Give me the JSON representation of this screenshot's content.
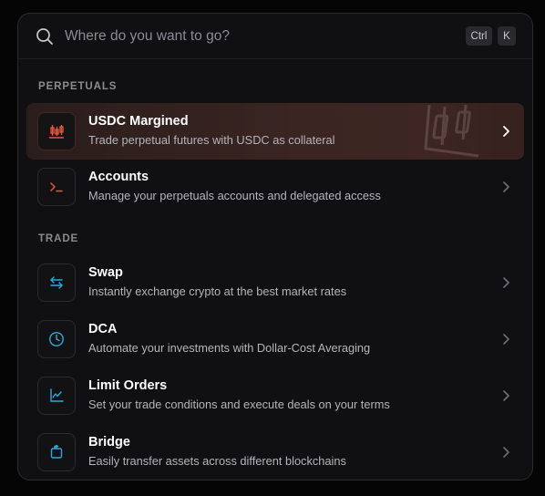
{
  "search": {
    "placeholder": "Where do you want to go?",
    "shortcut": [
      "Ctrl",
      "K"
    ]
  },
  "sections": [
    {
      "label": "PERPETUALS",
      "items": [
        {
          "title": "USDC Margined",
          "description": "Trade perpetual futures with USDC as collateral",
          "icon": "candlestick-icon",
          "active": true
        },
        {
          "title": "Accounts",
          "description": "Manage your perpetuals accounts and delegated access",
          "icon": "terminal-icon",
          "active": false
        }
      ]
    },
    {
      "label": "TRADE",
      "items": [
        {
          "title": "Swap",
          "description": "Instantly exchange crypto at the best market rates",
          "icon": "swap-arrows-icon",
          "active": false
        },
        {
          "title": "DCA",
          "description": "Automate your investments with Dollar-Cost Averaging",
          "icon": "clock-icon",
          "active": false
        },
        {
          "title": "Limit Orders",
          "description": "Set your trade conditions and execute deals on your terms",
          "icon": "line-chart-icon",
          "active": false
        },
        {
          "title": "Bridge",
          "description": "Easily transfer assets across different blockchains",
          "icon": "bridge-icon",
          "active": false
        }
      ]
    }
  ],
  "colors": {
    "accent_orange": "#e4573d",
    "accent_blue": "#2ea8d8",
    "chevron": "#6e6e75",
    "chevron_active": "#ffffff"
  }
}
